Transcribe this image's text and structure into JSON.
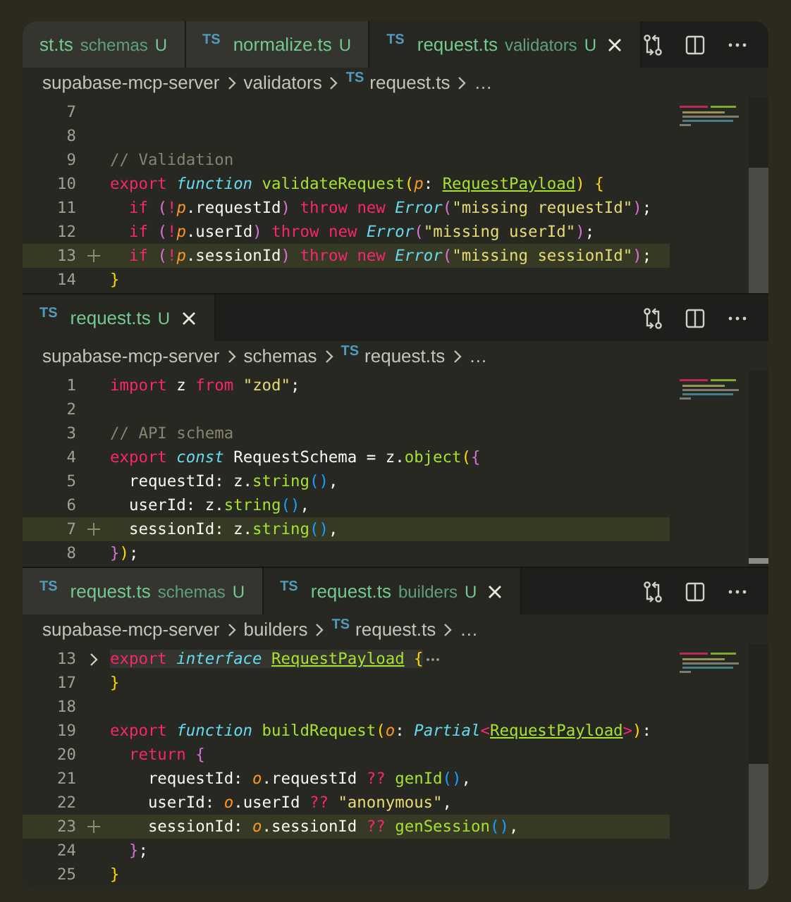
{
  "panes": [
    {
      "tabs": [
        {
          "name": "st.ts",
          "hint": "schemas",
          "status": "U",
          "selected": false
        },
        {
          "badge": "TS",
          "name": "normalize.ts",
          "status": "U",
          "selected": false
        },
        {
          "badge": "TS",
          "name": "request.ts",
          "hint": "validators",
          "status": "U",
          "selected": true
        }
      ],
      "breadcrumbs": [
        {
          "label": "supabase-mcp-server"
        },
        {
          "label": "validators"
        },
        {
          "badge": "TS",
          "label": "request.ts"
        },
        {
          "label": "…"
        }
      ],
      "lines": [
        {
          "number": "7"
        },
        {
          "number": "8"
        },
        {
          "number": "9",
          "added": false,
          "tokens": [
            {
              "text": "// Validation",
              "kind": "comment"
            }
          ]
        },
        {
          "number": "10",
          "added": false,
          "tokens": [
            {
              "text": "export ",
              "kind": "keyword"
            },
            {
              "text": "function ",
              "kind": "storage"
            },
            {
              "text": "validateRequest",
              "kind": "function"
            },
            {
              "text": "(",
              "kind": "bracket1"
            },
            {
              "text": "p",
              "kind": "param"
            },
            {
              "text": ": ",
              "kind": "plain"
            },
            {
              "text": "RequestPayload",
              "kind": "typeref"
            },
            {
              "text": ") {",
              "kind": "bracket1"
            }
          ]
        },
        {
          "number": "11",
          "added": false,
          "tokens": [
            {
              "text": "  if ",
              "kind": "keyword"
            },
            {
              "text": "(",
              "kind": "bracket2"
            },
            {
              "text": "!",
              "kind": "operator"
            },
            {
              "text": "p",
              "kind": "param"
            },
            {
              "text": ".requestId",
              "kind": "plain"
            },
            {
              "text": ") ",
              "kind": "bracket2"
            },
            {
              "text": "throw new ",
              "kind": "keyword"
            },
            {
              "text": "Error",
              "kind": "type"
            },
            {
              "text": "(",
              "kind": "bracket2"
            },
            {
              "text": "\"missing requestId\"",
              "kind": "string"
            },
            {
              "text": ")",
              "kind": "bracket2"
            },
            {
              "text": ";",
              "kind": "plain"
            }
          ]
        },
        {
          "number": "12",
          "added": false,
          "tokens": [
            {
              "text": "  if ",
              "kind": "keyword"
            },
            {
              "text": "(",
              "kind": "bracket2"
            },
            {
              "text": "!",
              "kind": "operator"
            },
            {
              "text": "p",
              "kind": "param"
            },
            {
              "text": ".userId",
              "kind": "plain"
            },
            {
              "text": ") ",
              "kind": "bracket2"
            },
            {
              "text": "throw new ",
              "kind": "keyword"
            },
            {
              "text": "Error",
              "kind": "type"
            },
            {
              "text": "(",
              "kind": "bracket2"
            },
            {
              "text": "\"missing userId\"",
              "kind": "string"
            },
            {
              "text": ")",
              "kind": "bracket2"
            },
            {
              "text": ";",
              "kind": "plain"
            }
          ]
        },
        {
          "number": "13",
          "added": true,
          "tokens": [
            {
              "text": "  if ",
              "kind": "keyword"
            },
            {
              "text": "(",
              "kind": "bracket2"
            },
            {
              "text": "!",
              "kind": "operator"
            },
            {
              "text": "p",
              "kind": "param"
            },
            {
              "text": ".sessionId",
              "kind": "plain"
            },
            {
              "text": ") ",
              "kind": "bracket2"
            },
            {
              "text": "throw new ",
              "kind": "keyword"
            },
            {
              "text": "Error",
              "kind": "type"
            },
            {
              "text": "(",
              "kind": "bracket2"
            },
            {
              "text": "\"missing sessionId\"",
              "kind": "string"
            },
            {
              "text": ")",
              "kind": "bracket2"
            },
            {
              "text": ";",
              "kind": "plain"
            }
          ]
        },
        {
          "number": "14",
          "added": false,
          "tokens": [
            {
              "text": "}",
              "kind": "bracket1"
            }
          ]
        }
      ]
    },
    {
      "tabs": [
        {
          "badge": "TS",
          "name": "request.ts",
          "status": "U",
          "selected": true
        }
      ],
      "breadcrumbs": [
        {
          "label": "supabase-mcp-server"
        },
        {
          "label": "schemas"
        },
        {
          "badge": "TS",
          "label": "request.ts"
        },
        {
          "label": "…"
        }
      ],
      "lines": [
        {
          "number": "1",
          "added": false,
          "tokens": [
            {
              "text": "import",
              "kind": "keyword"
            },
            {
              "text": " z ",
              "kind": "plain"
            },
            {
              "text": "from ",
              "kind": "keyword"
            },
            {
              "text": "\"zod\"",
              "kind": "string"
            },
            {
              "text": ";",
              "kind": "plain"
            }
          ]
        },
        {
          "number": "2"
        },
        {
          "number": "3",
          "added": false,
          "tokens": [
            {
              "text": "// API schema",
              "kind": "comment"
            }
          ]
        },
        {
          "number": "4",
          "added": false,
          "tokens": [
            {
              "text": "export ",
              "kind": "keyword"
            },
            {
              "text": "const",
              "kind": "storage"
            },
            {
              "text": " RequestSchema = z.",
              "kind": "plain"
            },
            {
              "text": "object",
              "kind": "function"
            },
            {
              "text": "(",
              "kind": "bracket1"
            },
            {
              "text": "{",
              "kind": "bracket2"
            }
          ]
        },
        {
          "number": "5",
          "added": false,
          "tokens": [
            {
              "text": "  requestId: z.",
              "kind": "plain"
            },
            {
              "text": "string",
              "kind": "function"
            },
            {
              "text": "()",
              "kind": "bracket3"
            },
            {
              "text": ",",
              "kind": "plain"
            }
          ]
        },
        {
          "number": "6",
          "added": false,
          "tokens": [
            {
              "text": "  userId: z.",
              "kind": "plain"
            },
            {
              "text": "string",
              "kind": "function"
            },
            {
              "text": "()",
              "kind": "bracket3"
            },
            {
              "text": ",",
              "kind": "plain"
            }
          ]
        },
        {
          "number": "7",
          "added": true,
          "tokens": [
            {
              "text": "  sessionId: z.",
              "kind": "plain"
            },
            {
              "text": "string",
              "kind": "function"
            },
            {
              "text": "()",
              "kind": "bracket3"
            },
            {
              "text": ",",
              "kind": "plain"
            }
          ]
        },
        {
          "number": "8",
          "added": false,
          "tokens": [
            {
              "text": "}",
              "kind": "bracket2"
            },
            {
              "text": ")",
              "kind": "bracket1"
            },
            {
              "text": ";",
              "kind": "plain"
            }
          ]
        }
      ]
    },
    {
      "tabs": [
        {
          "badge": "TS",
          "name": "request.ts",
          "hint": "schemas",
          "status": "U",
          "selected": false
        },
        {
          "badge": "TS",
          "name": "request.ts",
          "hint": "builders",
          "status": "U",
          "selected": true
        }
      ],
      "breadcrumbs": [
        {
          "label": "supabase-mcp-server"
        },
        {
          "label": "builders"
        },
        {
          "badge": "TS",
          "label": "request.ts"
        },
        {
          "label": "…"
        }
      ],
      "lines": [
        {
          "number": "13",
          "added": false,
          "current": true,
          "folded": true,
          "tokens": [
            {
              "text": "export ",
              "kind": "keyword"
            },
            {
              "text": "interface ",
              "kind": "storage"
            },
            {
              "text": "RequestPayload",
              "kind": "typeref"
            },
            {
              "text": " {",
              "kind": "bracket1"
            }
          ]
        },
        {
          "number": "17",
          "added": false,
          "tokens": [
            {
              "text": "}",
              "kind": "bracket1"
            }
          ]
        },
        {
          "number": "18"
        },
        {
          "number": "19",
          "added": false,
          "tokens": [
            {
              "text": "export ",
              "kind": "keyword"
            },
            {
              "text": "function ",
              "kind": "storage"
            },
            {
              "text": "buildRequest",
              "kind": "function"
            },
            {
              "text": "(",
              "kind": "bracket1"
            },
            {
              "text": "o",
              "kind": "param"
            },
            {
              "text": ": ",
              "kind": "plain"
            },
            {
              "text": "Partial",
              "kind": "type"
            },
            {
              "text": "<",
              "kind": "operator"
            },
            {
              "text": "RequestPayload",
              "kind": "typeref"
            },
            {
              "text": ">",
              "kind": "operator"
            },
            {
              "text": ")",
              "kind": "bracket1"
            },
            {
              "text": ":",
              "kind": "plain"
            }
          ]
        },
        {
          "number": "20",
          "added": false,
          "tokens": [
            {
              "text": "  return ",
              "kind": "keyword"
            },
            {
              "text": "{",
              "kind": "bracket2"
            }
          ]
        },
        {
          "number": "21",
          "added": false,
          "tokens": [
            {
              "text": "    requestId: ",
              "kind": "plain"
            },
            {
              "text": "o",
              "kind": "param"
            },
            {
              "text": ".requestId ",
              "kind": "plain"
            },
            {
              "text": "?? ",
              "kind": "operator"
            },
            {
              "text": "genId",
              "kind": "function"
            },
            {
              "text": "()",
              "kind": "bracket3"
            },
            {
              "text": ",",
              "kind": "plain"
            }
          ]
        },
        {
          "number": "22",
          "added": false,
          "tokens": [
            {
              "text": "    userId: ",
              "kind": "plain"
            },
            {
              "text": "o",
              "kind": "param"
            },
            {
              "text": ".userId ",
              "kind": "plain"
            },
            {
              "text": "?? ",
              "kind": "operator"
            },
            {
              "text": "\"anonymous\"",
              "kind": "string"
            },
            {
              "text": ",",
              "kind": "plain"
            }
          ]
        },
        {
          "number": "23",
          "added": true,
          "tokens": [
            {
              "text": "    sessionId: ",
              "kind": "plain"
            },
            {
              "text": "o",
              "kind": "param"
            },
            {
              "text": ".sessionId ",
              "kind": "plain"
            },
            {
              "text": "?? ",
              "kind": "operator"
            },
            {
              "text": "genSession",
              "kind": "function"
            },
            {
              "text": "()",
              "kind": "bracket3"
            },
            {
              "text": ",",
              "kind": "plain"
            }
          ]
        },
        {
          "number": "24",
          "added": false,
          "tokens": [
            {
              "text": "  }",
              "kind": "bracket2"
            },
            {
              "text": ";",
              "kind": "plain"
            }
          ]
        },
        {
          "number": "25",
          "added": false,
          "tokens": [
            {
              "text": "}",
              "kind": "bracket1"
            }
          ]
        }
      ]
    }
  ]
}
